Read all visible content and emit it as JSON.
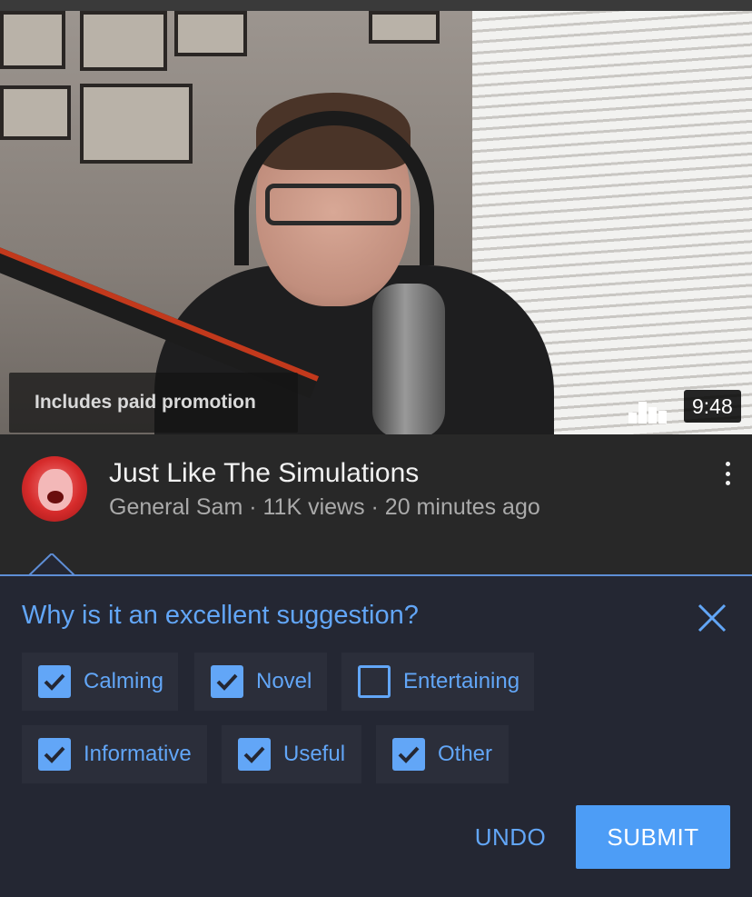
{
  "thumbnail": {
    "promo_label": "Includes paid promotion",
    "duration": "9:48"
  },
  "video": {
    "title": "Just Like The Simulations",
    "meta": "General Sam · 11K views · 20 minutes ago"
  },
  "feedback": {
    "question": "Why is it an excellent suggestion?",
    "options": [
      {
        "label": "Calming",
        "checked": true
      },
      {
        "label": "Novel",
        "checked": true
      },
      {
        "label": "Entertaining",
        "checked": false
      },
      {
        "label": "Informative",
        "checked": true
      },
      {
        "label": "Useful",
        "checked": true
      },
      {
        "label": "Other",
        "checked": true
      }
    ],
    "undo_label": "UNDO",
    "submit_label": "SUBMIT"
  },
  "colors": {
    "accent": "#62a6f7",
    "submit_bg": "#4d9df6",
    "panel_bg": "#242733"
  },
  "icons": [
    "more-vert-icon",
    "close-icon",
    "checkbox-checked-icon",
    "checkbox-unchecked-icon",
    "bars-icon"
  ]
}
